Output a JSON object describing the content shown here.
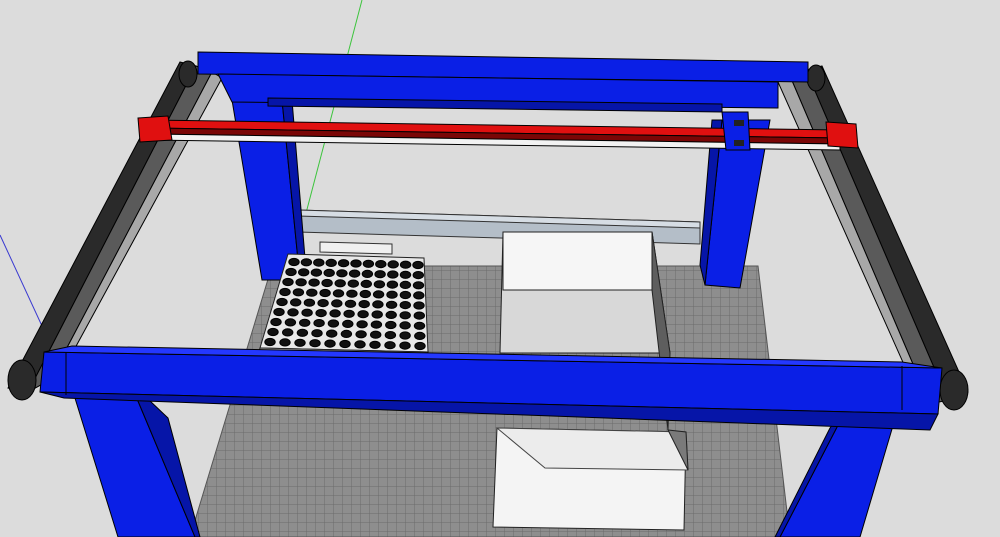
{
  "scene": {
    "kind": "3d-model-viewport",
    "colors": {
      "background": "#dcdcdc",
      "frame": "#0a1fe6",
      "frame_shade": "#0615a8",
      "gantry": "#e01010",
      "gantry_dark": "#7a0606",
      "rail": "#2a2a2a",
      "rail_light": "#5a5a5a",
      "bed": "#8e8e8e",
      "grid_line": "#6c6c6c",
      "container": "#f4f4f4",
      "plate": "#e8e8e8",
      "axis_green": "#3cc43c",
      "axis_blue": "#3a3ad0"
    },
    "objects": [
      "base-frame",
      "x-gantry",
      "y-rail-left",
      "y-rail-right",
      "work-bed",
      "well-plate",
      "container",
      "axis-lines"
    ],
    "well_plate": {
      "rows": 9,
      "cols": 11
    }
  }
}
